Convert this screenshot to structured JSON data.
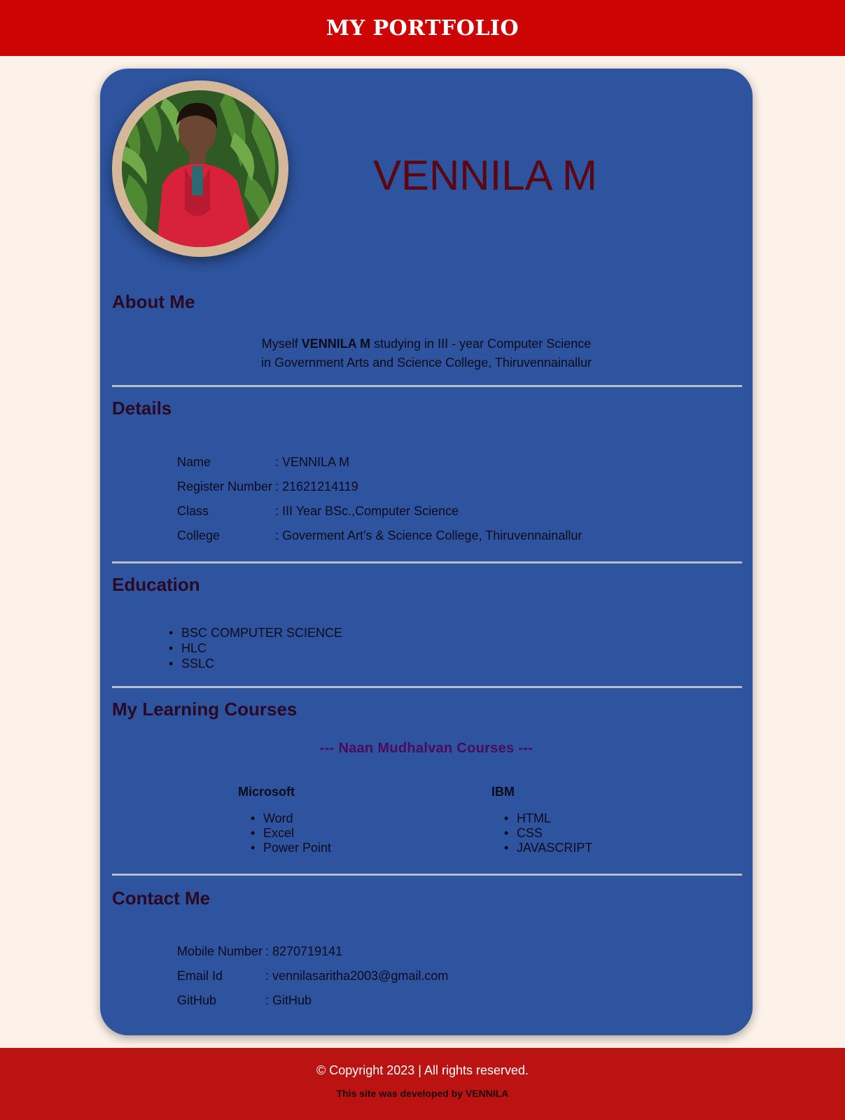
{
  "header": {
    "title": "MY PORTFOLIO"
  },
  "profile": {
    "name": "VENNILA M"
  },
  "about": {
    "title": "About Me",
    "prefix": "Myself ",
    "name_bold": "VENNILA M",
    "line1_rest": " studying in III - year Computer Science",
    "line2": "in Government Arts and Science College, Thiruvennainallur"
  },
  "details": {
    "title": "Details",
    "rows": [
      {
        "key": "Name",
        "value": "VENNILA M"
      },
      {
        "key": "Register Number",
        "value": "21621214119"
      },
      {
        "key": "Class",
        "value": "III Year BSc.,Computer Science"
      },
      {
        "key": "College",
        "value": "Goverment Art's & Science College, Thiruvennainallur"
      }
    ]
  },
  "education": {
    "title": "Education",
    "items": [
      "BSC COMPUTER SCIENCE",
      "HLC",
      "SSLC"
    ]
  },
  "courses": {
    "title": "My Learning Courses",
    "subtitle": "--- Naan Mudhalvan Courses ---",
    "groups": [
      {
        "name": "Microsoft",
        "items": [
          "Word",
          "Excel",
          "Power Point"
        ]
      },
      {
        "name": "IBM",
        "items": [
          "HTML",
          "CSS",
          "JAVASCRIPT"
        ]
      }
    ]
  },
  "contact": {
    "title": "Contact Me",
    "rows": [
      {
        "key": "Mobile Number",
        "value": "8270719141"
      },
      {
        "key": "Email Id",
        "value": "vennilasaritha2003@gmail.com"
      },
      {
        "key": "GitHub",
        "value": "GitHub"
      }
    ]
  },
  "footer": {
    "copyright": "© Copyright 2023 | All rights reserved.",
    "developer": "This site was developed by VENNILA"
  },
  "colors": {
    "header_bg": "#cc0404",
    "page_bg": "#fdf2ea",
    "card_bg": "#2e549f",
    "footer_bg": "#bb1212",
    "name_color": "#5a0712",
    "subtitle_color": "#4b0b58"
  }
}
